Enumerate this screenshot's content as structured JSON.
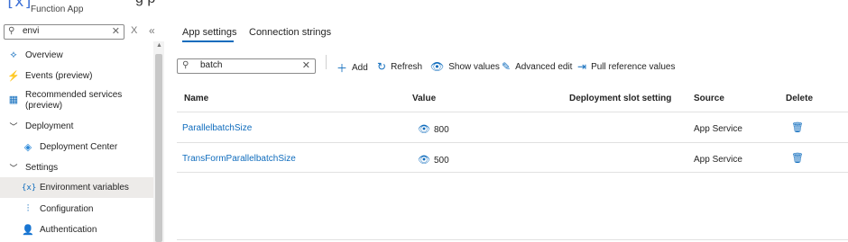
{
  "header": {
    "logo_text": "[x]",
    "subtitle": "Function App",
    "title_fragment": "g  p"
  },
  "left_search": {
    "value": "envi",
    "clear": "✕",
    "close": "X",
    "collapse": "«"
  },
  "sidebar": {
    "items": [
      {
        "label": "Overview",
        "icon": "overview-icon"
      },
      {
        "label": "Events (preview)",
        "icon": "lightning-icon"
      },
      {
        "label": "Recommended services\n(preview)",
        "icon": "grid-icon"
      },
      {
        "label": "Deployment",
        "icon": "chevron-down-icon"
      },
      {
        "label": "Deployment Center",
        "icon": "cube-icon"
      },
      {
        "label": "Settings",
        "icon": "chevron-down-icon"
      },
      {
        "label": "Environment variables",
        "icon": "variable-icon"
      },
      {
        "label": "Configuration",
        "icon": "sliders-icon"
      },
      {
        "label": "Authentication",
        "icon": "user-icon"
      }
    ]
  },
  "tabs": [
    {
      "label": "App settings",
      "selected": true
    },
    {
      "label": "Connection strings"
    }
  ],
  "filter": {
    "value": "batch"
  },
  "toolbar": {
    "add": "Add",
    "refresh": "Refresh",
    "show_values": "Show values",
    "advanced_edit": "Advanced edit",
    "pull_reference": "Pull reference values"
  },
  "table": {
    "headers": [
      "Name",
      "Value",
      "Deployment slot setting",
      "Source",
      "Delete"
    ],
    "rows": [
      {
        "name": "ParallelbatchSize",
        "value": "800",
        "slot": "",
        "source": "App Service"
      },
      {
        "name": "TransFormParallelbatchSize",
        "value": "500",
        "slot": "",
        "source": "App Service"
      }
    ]
  },
  "colors": {
    "accent": "#0f6cbd",
    "active_bg": "#edebe9"
  }
}
